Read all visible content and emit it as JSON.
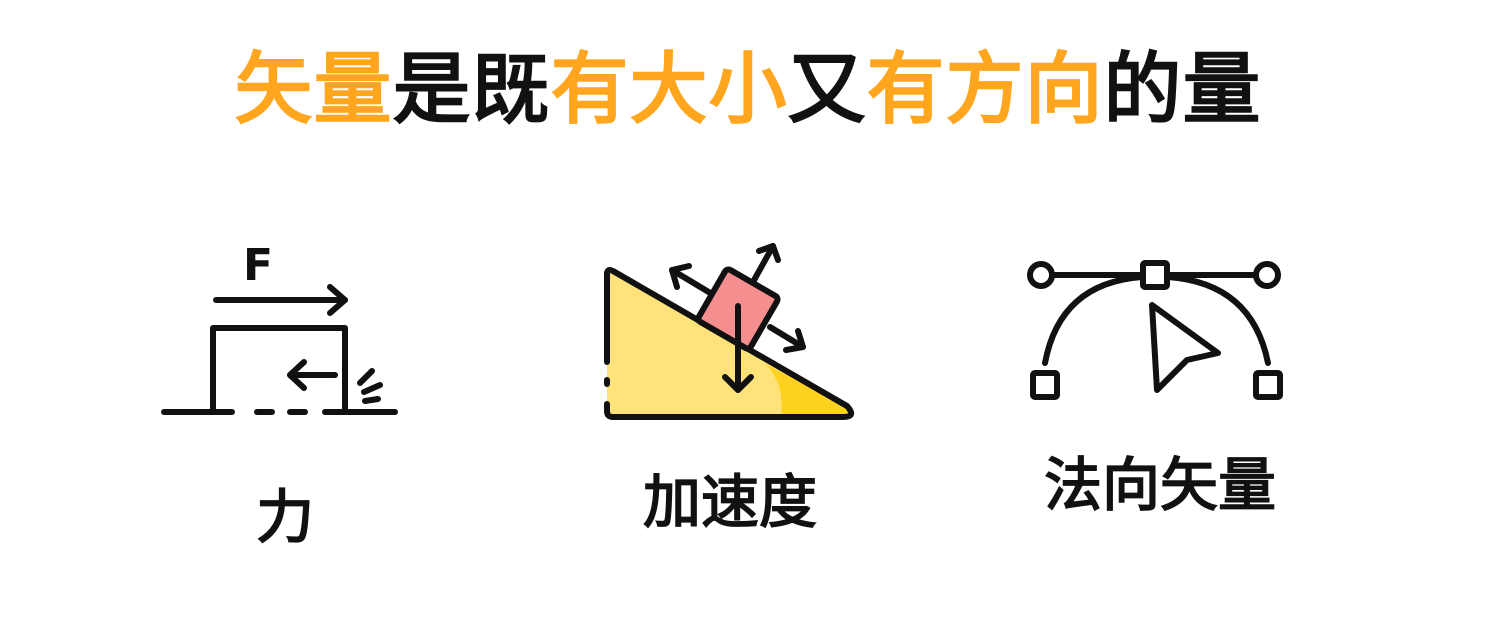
{
  "title": {
    "segments": [
      {
        "text": "矢量",
        "color": "#FFA51E"
      },
      {
        "text": "是既",
        "color": "#111111"
      },
      {
        "text": "有大小",
        "color": "#FFA51E"
      },
      {
        "text": "又",
        "color": "#111111"
      },
      {
        "text": "有方向",
        "color": "#FFA51E"
      },
      {
        "text": "的量",
        "color": "#111111"
      }
    ]
  },
  "items": [
    {
      "caption": "力",
      "icon": "force-icon",
      "icon_label": "F"
    },
    {
      "caption": "加速度",
      "icon": "incline-block-icon"
    },
    {
      "caption": "法向矢量",
      "icon": "bezier-pen-icon"
    }
  ],
  "colors": {
    "accent": "#FFA51E",
    "text": "#111111",
    "incline_fill": "#FFE27A",
    "incline_shade": "#FFD21F",
    "block_fill": "#F58F8F"
  }
}
